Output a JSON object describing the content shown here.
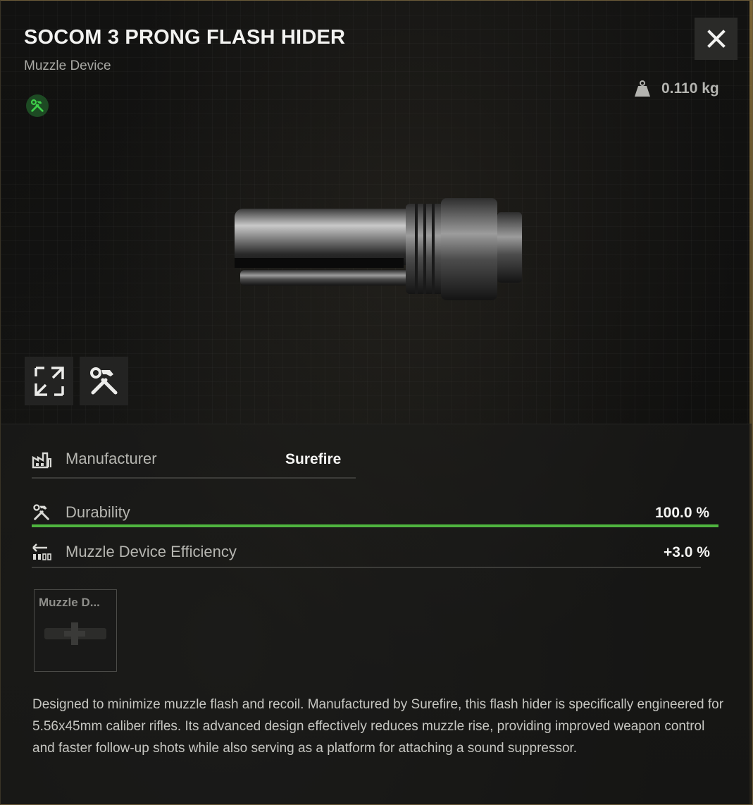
{
  "item": {
    "title": "SOCOM 3 PRONG FLASH HIDER",
    "subtitle": "Muzzle Device",
    "weight": "0.110 kg"
  },
  "icons": {
    "close": "close-icon",
    "repair_badge": "wrench-hammer-icon",
    "weight": "weight-icon",
    "collapse": "collapse-arrows-icon",
    "tools": "tools-icon",
    "manufacturer": "factory-icon",
    "durability": "tools-icon",
    "efficiency": "efficiency-icon"
  },
  "stats": {
    "manufacturer": {
      "label": "Manufacturer",
      "value": "Surefire"
    },
    "durability": {
      "label": "Durability",
      "value": "100.0 %",
      "fill": 1.0
    },
    "efficiency": {
      "label": "Muzzle Device Efficiency",
      "value": "+3.0 %"
    }
  },
  "slot": {
    "label": "Muzzle D..."
  },
  "description": "Designed to minimize muzzle flash and recoil. Manufactured by Surefire, this flash hider is specifically engineered for 5.56x45mm caliber rifles. Its advanced design effectively reduces muzzle rise, providing improved weapon control and faster follow-up shots while also serving as a platform for attaching a sound suppressor.",
  "colors": {
    "accent_green": "#4fb43f",
    "badge_green": "#1d4a23",
    "frame_gold": "#6a5a38"
  }
}
